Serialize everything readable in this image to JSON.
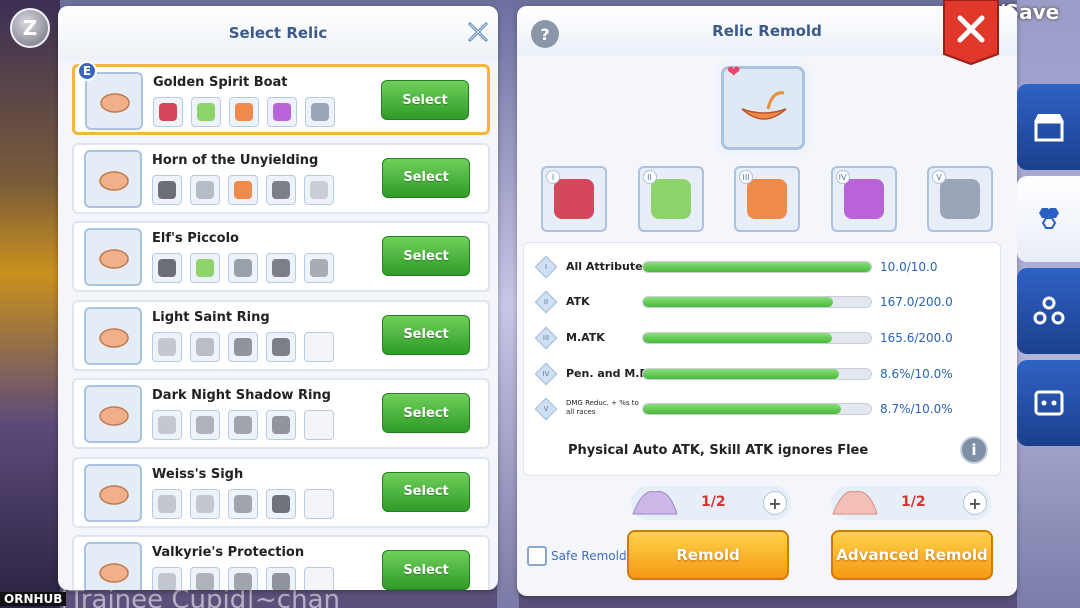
{
  "top": {
    "z_label": "Z",
    "save_text": "I/Save",
    "watermark": "ORNHUB",
    "bottom_text": "|Trainee Cupid|~chan"
  },
  "select_relic": {
    "title": "Select Relic",
    "items": [
      {
        "name": "Golden Spirit Boat",
        "badge": "E",
        "select_label": "Select",
        "selected": true,
        "parts": [
          "#d5475a",
          "#8fd46a",
          "#f08a4b",
          "#b864d8",
          "#9aa6b8"
        ]
      },
      {
        "name": "Horn of the Unyielding",
        "select_label": "Select",
        "parts": [
          "#6b6f78",
          "#b6bcc6",
          "#f08a4b",
          "#7a7f88",
          "#c9cdd4"
        ]
      },
      {
        "name": "Elf's Piccolo",
        "select_label": "Select",
        "parts": [
          "#6b6f78",
          "#8fd46a",
          "#9aa0aa",
          "#7a7f88",
          "#a7acb4"
        ]
      },
      {
        "name": "Light Saint Ring",
        "select_label": "Select",
        "parts": [
          "#c3c7cf",
          "#b9bdc5",
          "#8f949d",
          "#7a7f88",
          ""
        ]
      },
      {
        "name": "Dark Night Shadow Ring",
        "select_label": "Select",
        "parts": [
          "#c3c7cf",
          "#aeb3bb",
          "#a0a5ad",
          "#8f949d",
          ""
        ]
      },
      {
        "name": "Weiss's Sigh",
        "select_label": "Select",
        "parts": [
          "#c3c7cf",
          "#c3c7cf",
          "#a0a5ad",
          "#6f747c",
          ""
        ]
      },
      {
        "name": "Valkyrie's Protection",
        "select_label": "Select",
        "parts": [
          "#c3c7cf",
          "#aeb3bb",
          "#a0a5ad",
          "#8f949d",
          ""
        ]
      }
    ]
  },
  "relic_remold": {
    "title": "Relic Remold",
    "help_label": "?",
    "part_numerals": [
      "I",
      "II",
      "III",
      "IV",
      "V"
    ],
    "part_colors": [
      "#d5475a",
      "#8fd46a",
      "#f08a4b",
      "#b864d8",
      "#9aa6b8"
    ],
    "stats": [
      {
        "num": "I",
        "label": "All Attributes",
        "value": "10.0/10.0",
        "fill": 1.0,
        "small": false
      },
      {
        "num": "II",
        "label": "ATK",
        "value": "167.0/200.0",
        "fill": 0.835,
        "small": false
      },
      {
        "num": "III",
        "label": "M.ATK",
        "value": "165.6/200.0",
        "fill": 0.828,
        "small": false
      },
      {
        "num": "IV",
        "label": "Pen. and M.Pen.",
        "value": "8.6%/10.0%",
        "fill": 0.86,
        "small": false
      },
      {
        "num": "V",
        "label": "DMG Reduc. + %s to all races",
        "value": "8.7%/10.0%",
        "fill": 0.87,
        "small": true
      }
    ],
    "effect_text": "Physical Auto ATK, Skill ATK ignores Flee",
    "info_label": "i",
    "materials": [
      {
        "count": "1/2",
        "plus": "+"
      },
      {
        "count": "1/2",
        "plus": "+"
      }
    ],
    "safe_remold_label": "Safe Remold",
    "remold_label": "Remold",
    "advanced_remold_label": "Advanced Remold"
  }
}
